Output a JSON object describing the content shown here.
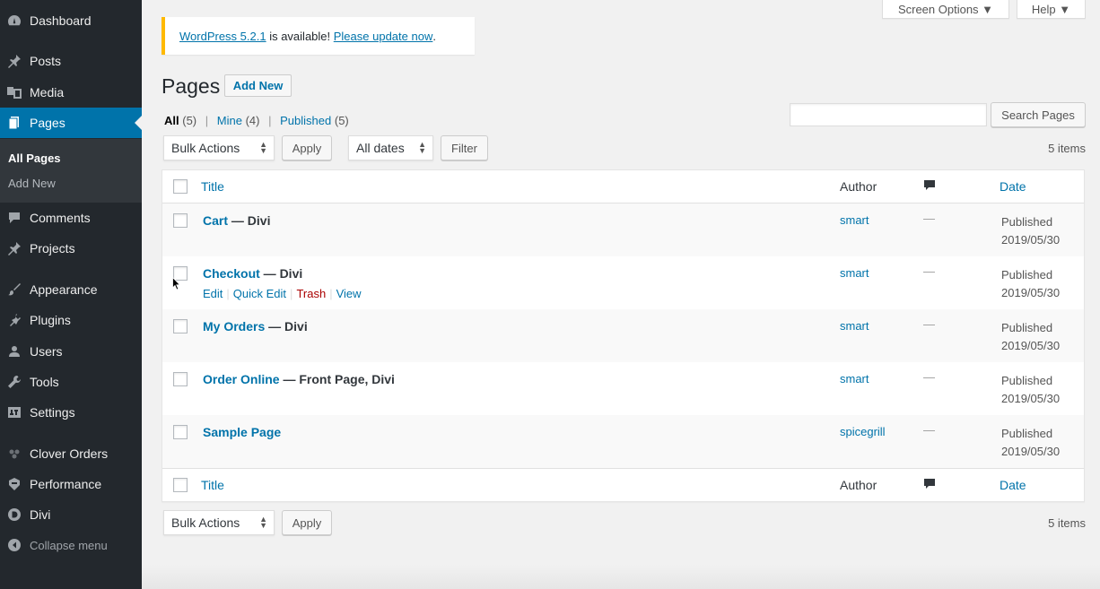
{
  "sidebar": {
    "items": [
      {
        "label": "Dashboard",
        "icon": "dashboard-icon"
      },
      {
        "label": "Posts",
        "icon": "pin-icon"
      },
      {
        "label": "Media",
        "icon": "media-icon"
      },
      {
        "label": "Pages",
        "icon": "pages-icon",
        "current": true
      },
      {
        "label": "Comments",
        "icon": "comment-icon"
      },
      {
        "label": "Projects",
        "icon": "pin-icon"
      },
      {
        "label": "Appearance",
        "icon": "brush-icon"
      },
      {
        "label": "Plugins",
        "icon": "plugin-icon"
      },
      {
        "label": "Users",
        "icon": "users-icon"
      },
      {
        "label": "Tools",
        "icon": "wrench-icon"
      },
      {
        "label": "Settings",
        "icon": "settings-icon"
      },
      {
        "label": "Clover Orders",
        "icon": "clover-icon"
      },
      {
        "label": "Performance",
        "icon": "performance-icon"
      },
      {
        "label": "Divi",
        "icon": "divi-icon"
      }
    ],
    "submenu": [
      {
        "label": "All Pages"
      },
      {
        "label": "Add New"
      }
    ],
    "collapse_label": "Collapse menu"
  },
  "screen_meta": {
    "screen_options": "Screen Options ▼",
    "help": "Help ▼"
  },
  "notice": {
    "version_link": "WordPress 5.2.1",
    "middle_text": " is available! ",
    "update_link": "Please update now",
    "end_text": "."
  },
  "heading": {
    "title": "Pages",
    "add_new": "Add New"
  },
  "views": {
    "all_label": "All",
    "all_count": "(5)",
    "mine_label": "Mine",
    "mine_count": "(4)",
    "published_label": "Published",
    "published_count": "(5)",
    "separator": "|"
  },
  "search": {
    "value": "",
    "button": "Search Pages"
  },
  "top_nav": {
    "bulk_actions": "Bulk Actions",
    "apply": "Apply",
    "all_dates": "All dates",
    "filter": "Filter",
    "items": "5 items"
  },
  "bottom_nav": {
    "bulk_actions": "Bulk Actions",
    "apply": "Apply",
    "items": "5 items"
  },
  "table": {
    "columns": {
      "title": "Title",
      "author": "Author",
      "comments_icon": "comment-bubble-icon",
      "date": "Date"
    },
    "rows": [
      {
        "title": "Cart",
        "state": " — Divi",
        "author": "smart",
        "comments": "—",
        "status": "Published",
        "date": "2019/05/30"
      },
      {
        "title": "Checkout",
        "state": " — Divi",
        "author": "smart",
        "comments": "—",
        "status": "Published",
        "date": "2019/05/30",
        "actions": {
          "edit": "Edit",
          "quick_edit": "Quick Edit",
          "trash": "Trash",
          "view": "View",
          "sep": "|"
        }
      },
      {
        "title": "My Orders",
        "state": " — Divi",
        "author": "smart",
        "comments": "—",
        "status": "Published",
        "date": "2019/05/30"
      },
      {
        "title": "Order Online",
        "state": " — Front Page, Divi",
        "author": "smart",
        "comments": "—",
        "status": "Published",
        "date": "2019/05/30"
      },
      {
        "title": "Sample Page",
        "state": "",
        "author": "spicegrill",
        "comments": "—",
        "status": "Published",
        "date": "2019/05/30"
      }
    ]
  },
  "colors": {
    "sidebar_bg": "#23282d",
    "current_menu_bg": "#0073aa",
    "link": "#0073aa",
    "notice_border": "#ffb900",
    "trash": "#aa0000"
  }
}
